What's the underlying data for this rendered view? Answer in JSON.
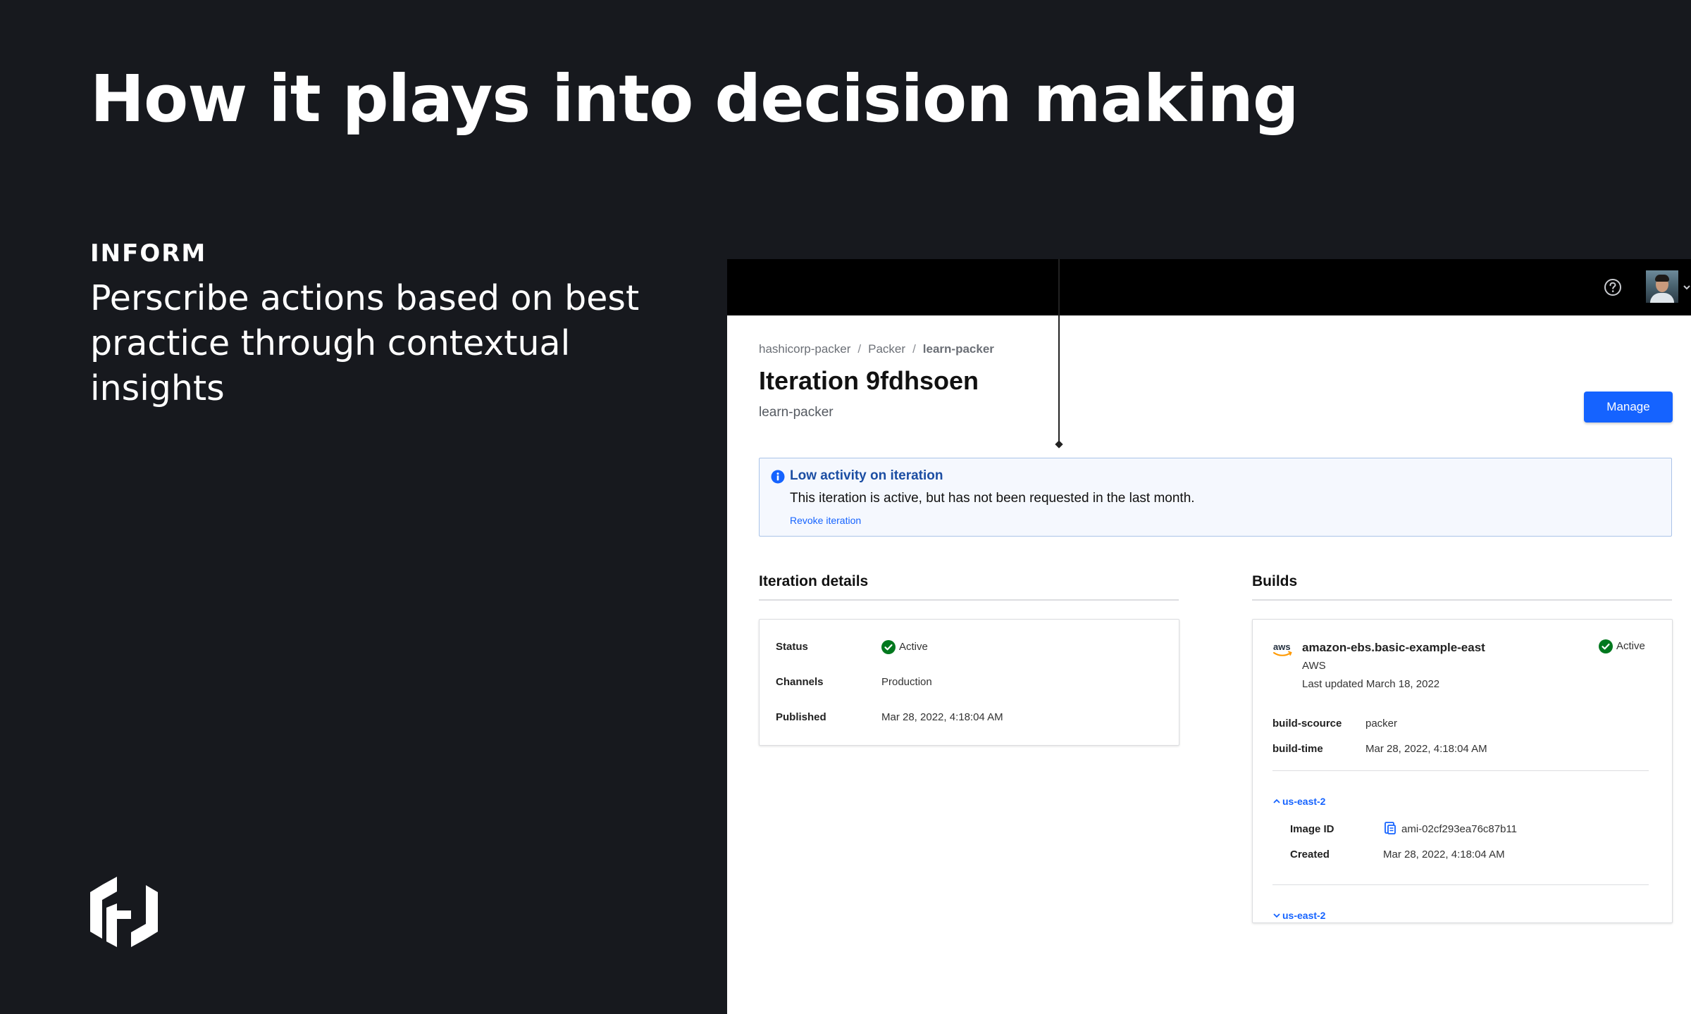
{
  "slide": {
    "title": "How it plays into decision making",
    "section_label": "INFORM",
    "section_description": "Perscribe actions based on best practice through contextual insights"
  },
  "screenshot": {
    "breadcrumb": [
      "hashicorp-packer",
      "Packer",
      "learn-packer"
    ],
    "page_title": "Iteration 9fdhsoen",
    "page_subtitle": "learn-packer",
    "manage_label": "Manage",
    "alert": {
      "title": "Low activity on iteration",
      "body": "This iteration is active, but has not been requested in the last month.",
      "link": "Revoke iteration"
    },
    "details": {
      "heading": "Iteration details",
      "status_label": "Status",
      "status_value": "Active",
      "channels_label": "Channels",
      "channels_value": "Production",
      "published_label": "Published",
      "published_value": "Mar 28, 2022, 4:18:04 AM"
    },
    "builds": {
      "heading": "Builds",
      "name": "amazon-ebs.basic-example-east",
      "provider": "AWS",
      "updated": "Last updated March 18, 2022",
      "status": "Active",
      "source_label": "build-scource",
      "source_value": "packer",
      "time_label": "build-time",
      "time_value": "Mar 28, 2022, 4:18:04 AM",
      "region_expanded": "us-east-2",
      "image_id_label": "Image ID",
      "image_id_value": "ami-02cf293ea76c87b11",
      "created_label": "Created",
      "created_value": "Mar 28, 2022, 4:18:04 AM",
      "region_collapsed": "us-east-2"
    }
  },
  "colors": {
    "slide_bg": "#17191e",
    "primary_blue": "#1563ff",
    "success_green": "#00781e",
    "alert_title": "#1c4ea3"
  }
}
